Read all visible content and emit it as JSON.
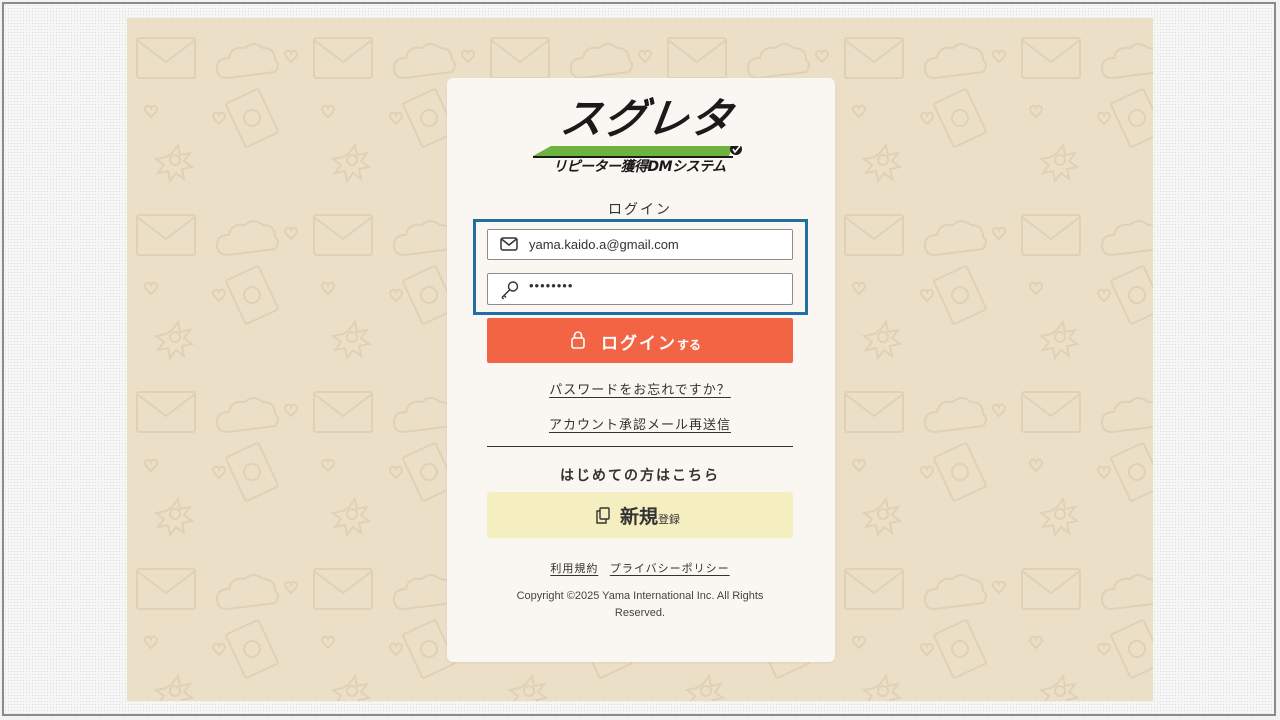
{
  "brand": {
    "logo_main": "スグレタ",
    "logo_sub": "リピーター獲得DMシステム",
    "accent_green": "#6cb33f"
  },
  "login": {
    "heading": "ログイン",
    "email_value": "yama.kaido.a@gmail.com",
    "email_icon": "envelope-icon",
    "password_value": "••••••••",
    "password_icon": "key-icon",
    "button_label_main": "ログイン",
    "button_label_small": "する",
    "button_icon": "lock-icon",
    "button_color": "#f26444"
  },
  "links": {
    "forgot_password": "パスワードをお忘れですか？",
    "resend_confirmation": "アカウント承認メール再送信"
  },
  "signup": {
    "heading": "はじめての方はこちら",
    "button_label_main": "新規",
    "button_label_small": "登録",
    "button_icon": "copy-icon",
    "button_color": "#f5eec0"
  },
  "footer": {
    "terms": "利用規約",
    "privacy": "プライバシーポリシー",
    "copyright": "Copyright ©2025 Yama International Inc. All Rights Reserved."
  },
  "colors": {
    "background": "#ebdfc8",
    "card": "#faf6f1",
    "highlight_border": "#1f6fa0"
  }
}
